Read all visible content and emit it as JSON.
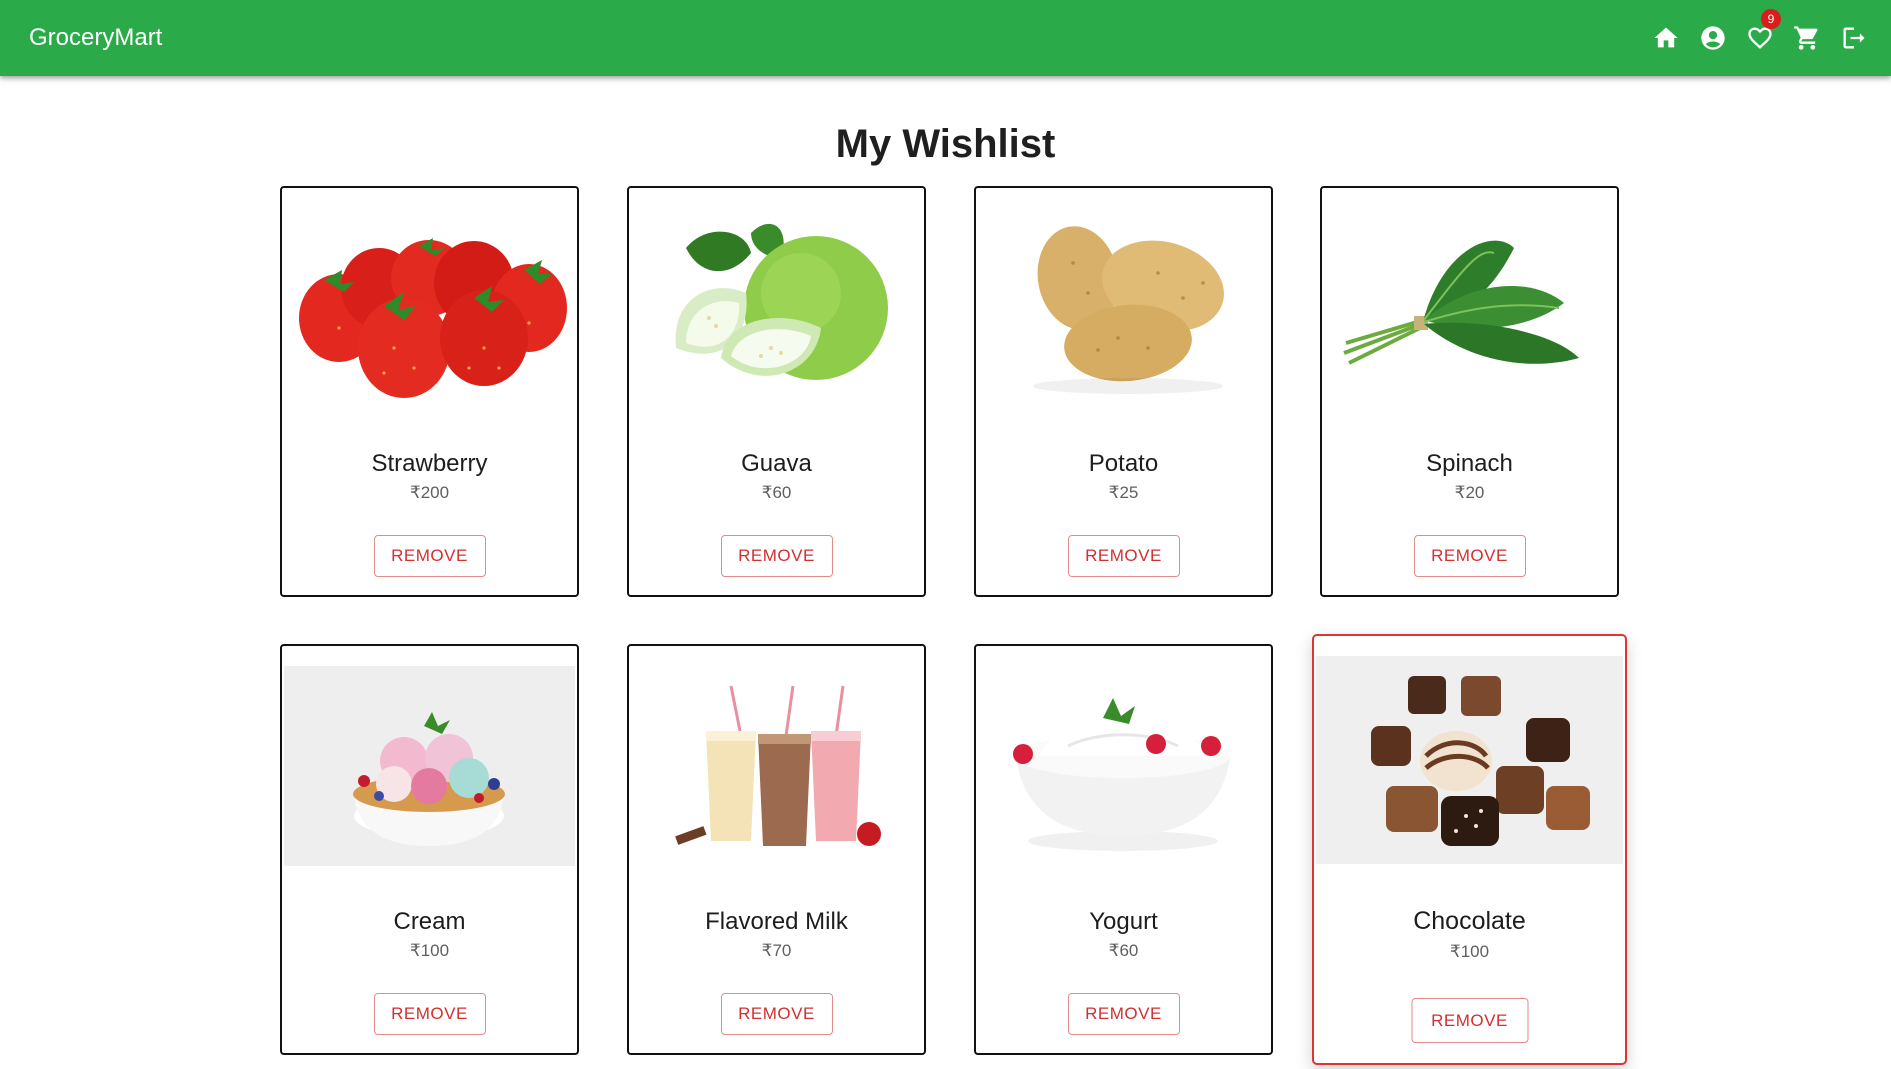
{
  "header": {
    "brand": "GroceryMart",
    "icons": [
      "home-icon",
      "account-icon",
      "wishlist-icon",
      "cart-icon",
      "logout-icon"
    ],
    "wishlist_badge": "9",
    "bg_color": "#2aaa48"
  },
  "page": {
    "title": "My Wishlist"
  },
  "wishlist": {
    "items": [
      {
        "name": "Strawberry",
        "price": "₹200",
        "remove_label": "REMOVE"
      },
      {
        "name": "Guava",
        "price": "₹60",
        "remove_label": "REMOVE"
      },
      {
        "name": "Potato",
        "price": "₹25",
        "remove_label": "REMOVE"
      },
      {
        "name": "Spinach",
        "price": "₹20",
        "remove_label": "REMOVE"
      },
      {
        "name": "Cream",
        "price": "₹100",
        "remove_label": "REMOVE"
      },
      {
        "name": "Flavored Milk",
        "price": "₹70",
        "remove_label": "REMOVE"
      },
      {
        "name": "Yogurt",
        "price": "₹60",
        "remove_label": "REMOVE"
      },
      {
        "name": "Chocolate",
        "price": "₹100",
        "remove_label": "REMOVE"
      }
    ],
    "hovered_item": "Chocolate",
    "accent_remove_color": "#d32f2f"
  }
}
